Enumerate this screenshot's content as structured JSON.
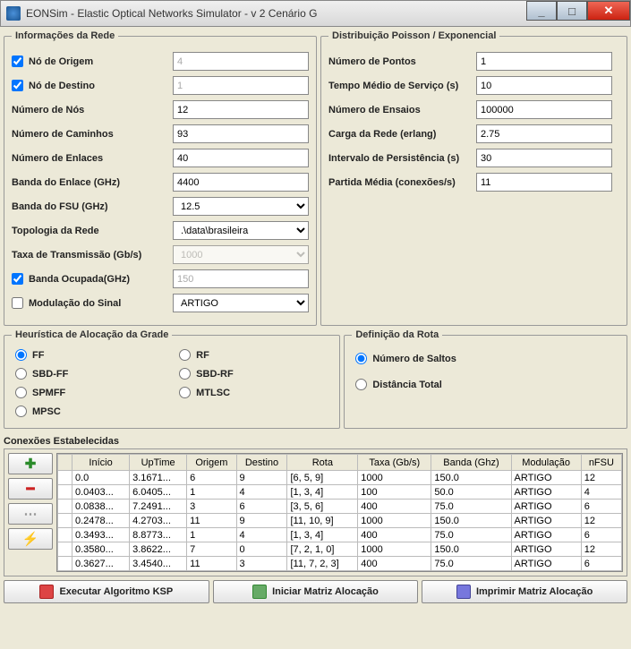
{
  "window": {
    "title": "EONSim -   Elastic Optical Networks Simulator - v 2 Cenário G"
  },
  "rede": {
    "legend": "Informações da Rede",
    "no_origem_label": "Nó de Origem",
    "no_origem_value": "4",
    "no_destino_label": "Nó de Destino",
    "no_destino_value": "1",
    "num_nos_label": "Número de Nós",
    "num_nos_value": "12",
    "num_caminhos_label": "Número de Caminhos",
    "num_caminhos_value": "93",
    "num_enlaces_label": "Número de Enlaces",
    "num_enlaces_value": "40",
    "banda_enlace_label": "Banda do Enlace (GHz)",
    "banda_enlace_value": "4400",
    "banda_fsu_label": "Banda do FSU (GHz)",
    "banda_fsu_value": "12.5",
    "topologia_label": "Topologia da Rede",
    "topologia_value": ".\\data\\brasileira",
    "taxa_label": "Taxa de Transmissão (Gb/s)",
    "taxa_value": "1000",
    "banda_ocupada_label": "Banda Ocupada(GHz)",
    "banda_ocupada_value": "150",
    "modulacao_label": "Modulação do Sinal",
    "modulacao_value": "ARTIGO"
  },
  "poisson": {
    "legend": "Distribuição Poisson / Exponencial",
    "num_pontos_label": "Número de Pontos",
    "num_pontos_value": "1",
    "tempo_servico_label": "Tempo Médio de Serviço (s)",
    "tempo_servico_value": "10",
    "num_ensaios_label": "Número de Ensaios",
    "num_ensaios_value": "100000",
    "carga_label": "Carga da Rede (erlang)",
    "carga_value": "2.75",
    "intervalo_label": "Intervalo de Persistência (s)",
    "intervalo_value": "30",
    "partida_label": "Partida Média (conexões/s)",
    "partida_value": "11"
  },
  "heuristica": {
    "legend": "Heurística de Alocação da Grade",
    "options": [
      "FF",
      "RF",
      "SBD-FF",
      "SBD-RF",
      "SPMFF",
      "MTLSC",
      "MPSC"
    ],
    "selected": "FF"
  },
  "rota": {
    "legend": "Definição da Rota",
    "opt1": "Número de Saltos",
    "opt2": "Distância Total",
    "selected": "Número de Saltos"
  },
  "connections": {
    "label": "Conexões Estabelecidas",
    "headers": [
      "Início",
      "UpTime",
      "Origem",
      "Destino",
      "Rota",
      "Taxa (Gb/s)",
      "Banda (Ghz)",
      "Modulação",
      "nFSU"
    ],
    "rows": [
      [
        "0.0",
        "3.1671...",
        "6",
        "9",
        "[6, 5, 9]",
        "1000",
        "150.0",
        "ARTIGO",
        "12"
      ],
      [
        "0.0403...",
        "6.0405...",
        "1",
        "4",
        "[1, 3, 4]",
        "100",
        "50.0",
        "ARTIGO",
        "4"
      ],
      [
        "0.0838...",
        "7.2491...",
        "3",
        "6",
        "[3, 5, 6]",
        "400",
        "75.0",
        "ARTIGO",
        "6"
      ],
      [
        "0.2478...",
        "4.2703...",
        "11",
        "9",
        "[11, 10, 9]",
        "1000",
        "150.0",
        "ARTIGO",
        "12"
      ],
      [
        "0.3493...",
        "8.8773...",
        "1",
        "4",
        "[1, 3, 4]",
        "400",
        "75.0",
        "ARTIGO",
        "6"
      ],
      [
        "0.3580...",
        "3.8622...",
        "7",
        "0",
        "[7, 2, 1, 0]",
        "1000",
        "150.0",
        "ARTIGO",
        "12"
      ],
      [
        "0.3627...",
        "3.4540...",
        "11",
        "3",
        "[11, 7, 2, 3]",
        "400",
        "75.0",
        "ARTIGO",
        "6"
      ]
    ]
  },
  "buttons": {
    "ksp": "Executar Algoritmo KSP",
    "iniciar": "Iniciar Matriz Alocação",
    "imprimir": "Imprimir Matriz Alocação"
  }
}
